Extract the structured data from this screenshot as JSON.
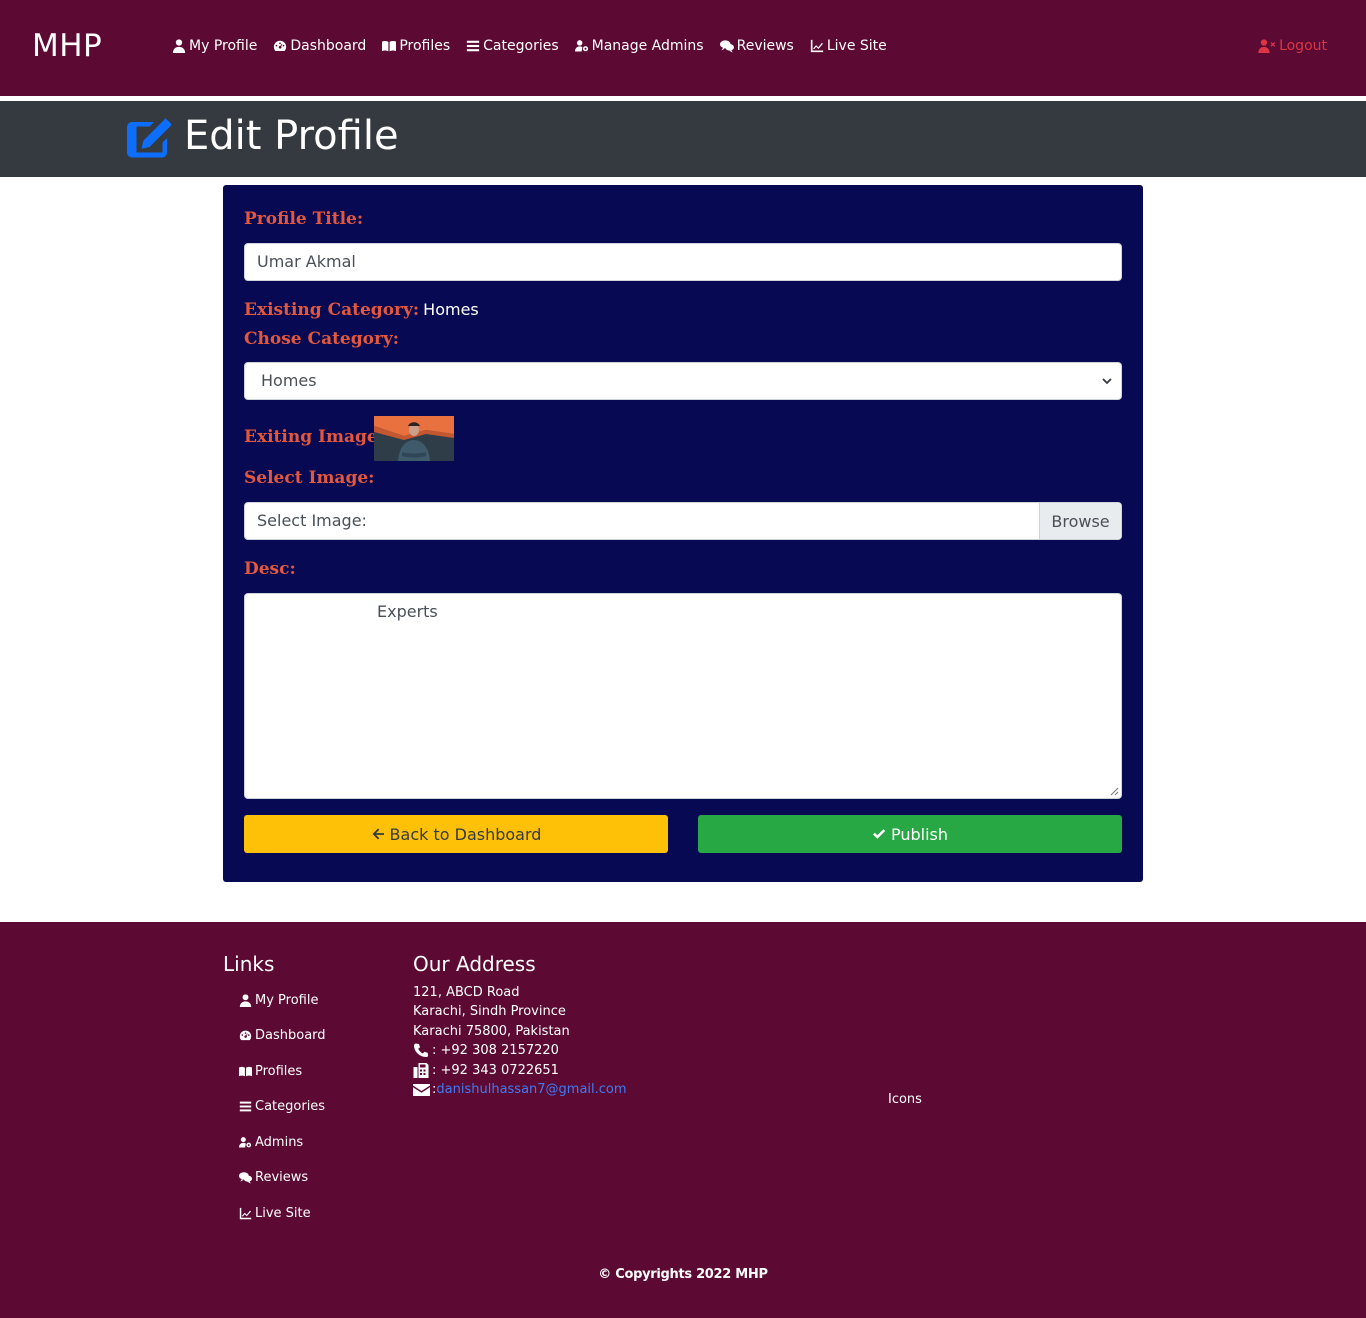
{
  "navbar": {
    "brand": "MHP",
    "links": [
      {
        "label": "My Profile",
        "icon": "user-icon"
      },
      {
        "label": "Dashboard",
        "icon": "tachometer-icon"
      },
      {
        "label": "Profiles",
        "icon": "book-icon"
      },
      {
        "label": "Categories",
        "icon": "list-icon"
      },
      {
        "label": "Manage Admins",
        "icon": "user-cog-icon"
      },
      {
        "label": "Reviews",
        "icon": "comments-icon"
      },
      {
        "label": "Live Site",
        "icon": "chart-line-icon"
      }
    ],
    "logout": "Logout",
    "logout_color": "#dc3545"
  },
  "header": {
    "title": "Edit Profile",
    "icon_color": "#0d6efd"
  },
  "form": {
    "title_label": "Profile Title:",
    "title_value": "Umar Akmal",
    "existing_category_label": "Existing Category:",
    "existing_category_value": "Homes",
    "choose_category_label": "Chose Category:",
    "category_selected": "Homes",
    "existing_image_label": "Exiting Image:",
    "select_image_label": "Select Image:",
    "select_image_placeholder": "Select Image:",
    "browse_label": "Browse",
    "desc_label": "Desc:",
    "desc_value": "Experts",
    "back_button": "Back to Dashboard",
    "publish_button": "Publish"
  },
  "footer": {
    "links_heading": "Links",
    "links": [
      {
        "label": "My Profile",
        "icon": "user-icon"
      },
      {
        "label": "Dashboard",
        "icon": "tachometer-icon"
      },
      {
        "label": "Profiles",
        "icon": "book-icon"
      },
      {
        "label": "Categories",
        "icon": "list-icon"
      },
      {
        "label": "Admins",
        "icon": "user-cog-icon"
      },
      {
        "label": "Reviews",
        "icon": "comments-icon"
      },
      {
        "label": "Live Site",
        "icon": "chart-line-icon"
      }
    ],
    "address_heading": "Our Address",
    "address_line1": "121, ABCD Road",
    "address_line2": "Karachi, Sindh Province",
    "address_line3": "Karachi 75800, Pakistan",
    "phone": ": +92 308 2157220",
    "fax": ": +92 343 0722651",
    "email_sep": ":",
    "email": "danishulhassan7@gmail.com",
    "icons_text": "Icons",
    "copyright": "© Copyrights 2022 MHP"
  }
}
